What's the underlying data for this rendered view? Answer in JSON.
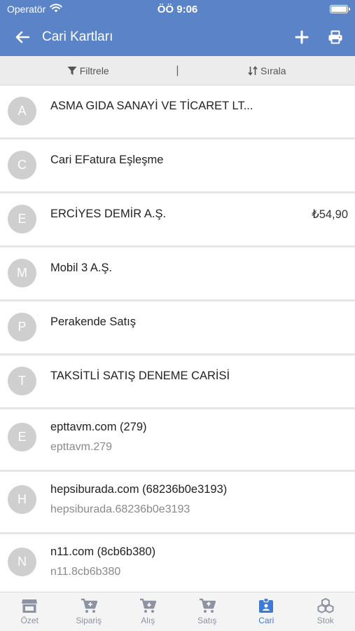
{
  "status": {
    "carrier": "Operatör",
    "time": "ÖÖ 9:06"
  },
  "nav": {
    "title": "Cari Kartları"
  },
  "toolbar": {
    "filter_label": "Filtrele",
    "separator": "|",
    "sort_label": "Sırala"
  },
  "items": [
    {
      "initial": "A",
      "title": "ASMA GIDA SANAYİ VE TİCARET LT...",
      "subtitle": "",
      "amount": ""
    },
    {
      "initial": "C",
      "title": "Cari EFatura Eşleşme",
      "subtitle": "",
      "amount": ""
    },
    {
      "initial": "E",
      "title": "ERCİYES DEMİR A.Ş.",
      "subtitle": "",
      "amount": "₺54,90"
    },
    {
      "initial": "M",
      "title": "Mobil 3 A.Ş.",
      "subtitle": "",
      "amount": ""
    },
    {
      "initial": "P",
      "title": "Perakende Satış",
      "subtitle": "",
      "amount": ""
    },
    {
      "initial": "T",
      "title": "TAKSİTLİ SATIŞ DENEME CARİSİ",
      "subtitle": "",
      "amount": ""
    },
    {
      "initial": "E",
      "title": "epttavm.com (279)",
      "subtitle": "epttavm.279",
      "amount": ""
    },
    {
      "initial": "H",
      "title": "hepsiburada.com (68236b0e3193)",
      "subtitle": "hepsiburada.68236b0e3193",
      "amount": ""
    },
    {
      "initial": "N",
      "title": "n11.com (8cb6b380)",
      "subtitle": "n11.8cb6b380",
      "amount": ""
    }
  ],
  "tabs": [
    {
      "label": "Özet",
      "icon": "store-icon",
      "active": false
    },
    {
      "label": "Sipariş",
      "icon": "cart-icon",
      "active": false
    },
    {
      "label": "Alış",
      "icon": "cart-download-icon",
      "active": false
    },
    {
      "label": "Satış",
      "icon": "cart-upload-icon",
      "active": false
    },
    {
      "label": "Cari",
      "icon": "id-badge-icon",
      "active": true
    },
    {
      "label": "Stok",
      "icon": "boxes-icon",
      "active": false
    }
  ],
  "colors": {
    "header": "#5b84c8",
    "active_tab": "#3d7ad6",
    "inactive_tab": "#8d93a3",
    "avatar": "#cfcfcf"
  }
}
